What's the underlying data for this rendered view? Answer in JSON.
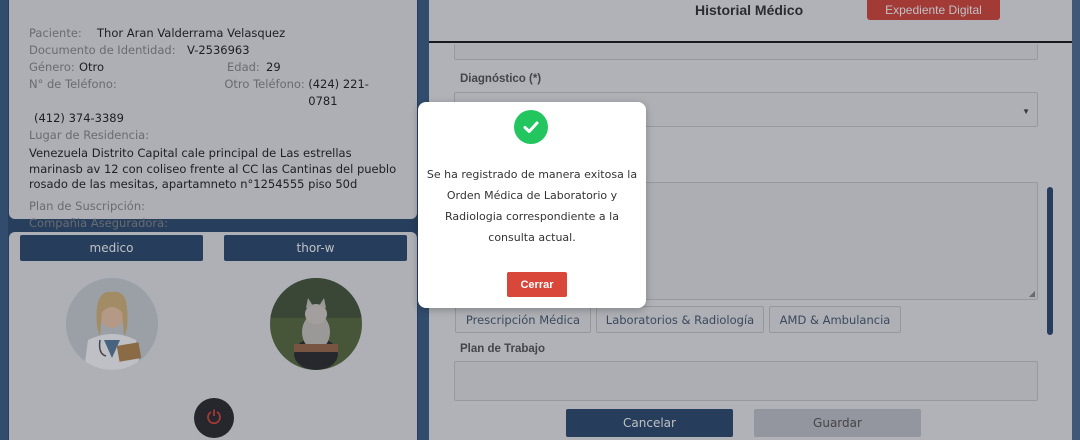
{
  "patient": {
    "patient_label": "Paciente:",
    "patient_name": "Thor Aran Valderrama Velasquez",
    "id_label": "Documento de Identidad:",
    "id_value": "V-2536963",
    "gender_label": "Género:",
    "gender_value": "Otro",
    "age_label": "Edad:",
    "age_value": "29",
    "phone_label": "N° de Teléfono:",
    "phone_value": "(412) 374-3389",
    "other_phone_label": "Otro Teléfono:",
    "other_phone_value": "(424) 221-0781",
    "residence_label": "Lugar de Residencia:",
    "residence_value": "Venezuela Distrito Capital cale principal de Las estrellas marinasb av 12 con coliseo frente al CC las Cantinas del pueblo rosado de las mesitas, apartamneto n°1254555 piso 50d",
    "plan_label": "Plan de Suscripción:",
    "insurer_label": "Compañia Aseguradora:"
  },
  "users": {
    "doctor_label": "medico",
    "patient_user_label": "thor-w"
  },
  "history": {
    "title": "Historial Médico",
    "expediente_button": "Expediente Digital",
    "diagnosis_label": "Diagnóstico (*)",
    "tabs": [
      "Prescripción Médica",
      "Laboratorios & Radiología",
      "AMD & Ambulancia"
    ],
    "work_plan_label": "Plan de Trabajo",
    "cancel_button": "Cancelar",
    "save_button": "Guardar"
  },
  "modal": {
    "message": "Se ha registrado de manera exitosa la Orden Médica de Laboratorio y Radiologia correspondiente a la consulta actual.",
    "close_button": "Cerrar",
    "icon": "check-circle-icon",
    "success_color": "#22c55e"
  },
  "colors": {
    "primary": "#2d4a6c",
    "danger": "#d9463a"
  }
}
